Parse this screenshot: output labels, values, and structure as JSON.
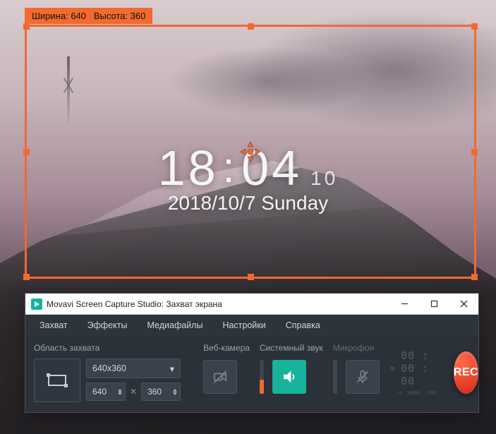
{
  "capture": {
    "width_label": "Ширина:",
    "height_label": "Высота:",
    "width": "640",
    "height": "360"
  },
  "wallpaper_clock": {
    "hh": "18",
    "mm": "04",
    "ss": "10",
    "date": "2018/10/7 Sunday"
  },
  "window": {
    "title": "Movavi Screen Capture Studio: Захват экрана"
  },
  "menu": {
    "capture": "Захват",
    "effects": "Эффекты",
    "media": "Медиафайлы",
    "settings": "Настройки",
    "help": "Справка"
  },
  "panel": {
    "area_label": "Область захвата",
    "preset": "640x360",
    "width": "640",
    "height": "360",
    "webcam_label": "Веб-камера",
    "system_sound_label": "Системный звук",
    "mic_label": "Микрофон",
    "timer": "00 : 00 : 00",
    "timer_units": {
      "h": "ч",
      "m": "мин",
      "s": "сек"
    },
    "rec_label": "REC"
  },
  "colors": {
    "accent": "#f16a2f",
    "active": "#17b39b"
  }
}
